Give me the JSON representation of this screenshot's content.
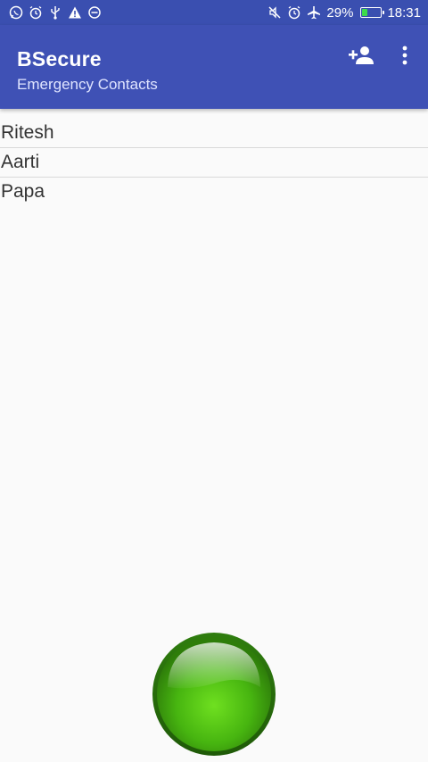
{
  "status_bar": {
    "left_icons": [
      "whatsapp-icon",
      "alarm-icon",
      "usb-icon",
      "warning-icon",
      "minus-circle-icon"
    ],
    "right_icons": [
      "mute-vibrate-icon",
      "alarm-clock-icon",
      "airplane-icon"
    ],
    "battery_percent": "29%",
    "battery_level": 0.29,
    "time": "18:31"
  },
  "app_bar": {
    "title": "BSecure",
    "subtitle": "Emergency Contacts",
    "actions": [
      "add-contact-icon",
      "more-options-icon"
    ]
  },
  "contacts": [
    {
      "name": "Ritesh"
    },
    {
      "name": "Aarti"
    },
    {
      "name": "Papa"
    }
  ],
  "colors": {
    "primary": "#3f51b5",
    "status_bar": "#3a4fb0",
    "panic_button": "#4fc21a"
  }
}
